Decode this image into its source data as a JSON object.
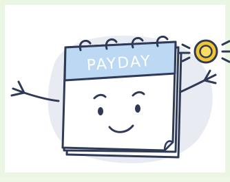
{
  "illustration": {
    "calendar_heading": "PAYDAY",
    "colors": {
      "background_blob": "#e9ebf3",
      "calendar_header": "#bcd8f3",
      "calendar_page": "#ffffff",
      "outline": "#2f3a56",
      "coin_outer": "#f2c630",
      "coin_inner": "#f9dc63"
    },
    "icons": [
      "calendar-character",
      "coin-icon",
      "sparkle-lines"
    ]
  }
}
